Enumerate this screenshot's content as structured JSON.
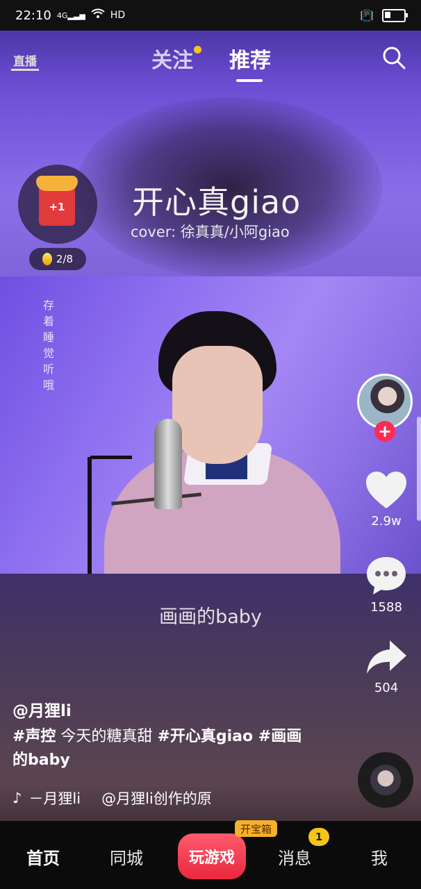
{
  "status": {
    "time": "22:10",
    "network": "4G",
    "hd": "HD"
  },
  "topnav": {
    "live_label": "直播",
    "tab_follow": "关注",
    "tab_recommend": "推荐"
  },
  "video": {
    "song_title": "开心真giao",
    "song_cover": "cover: 徐真真/小阿giao",
    "side_text": "存着睡觉听哦",
    "lyric": "画画的baby"
  },
  "reward": {
    "plus": "+1",
    "progress": "2/8"
  },
  "actions": {
    "likes": "2.9w",
    "comments": "1588",
    "shares": "504"
  },
  "post": {
    "author": "@月狸li",
    "tag1": "#声控",
    "text1": " 今天的糖真甜 ",
    "tag2": "#开心真giao",
    "tag3": " #画画的baby",
    "music_name": "－月狸li",
    "music_credit": "@月狸li创作的原"
  },
  "bottomnav": {
    "home": "首页",
    "local": "同城",
    "game": "玩游戏",
    "chest": "开宝箱",
    "messages": "消息",
    "messages_badge": "1",
    "me": "我"
  }
}
